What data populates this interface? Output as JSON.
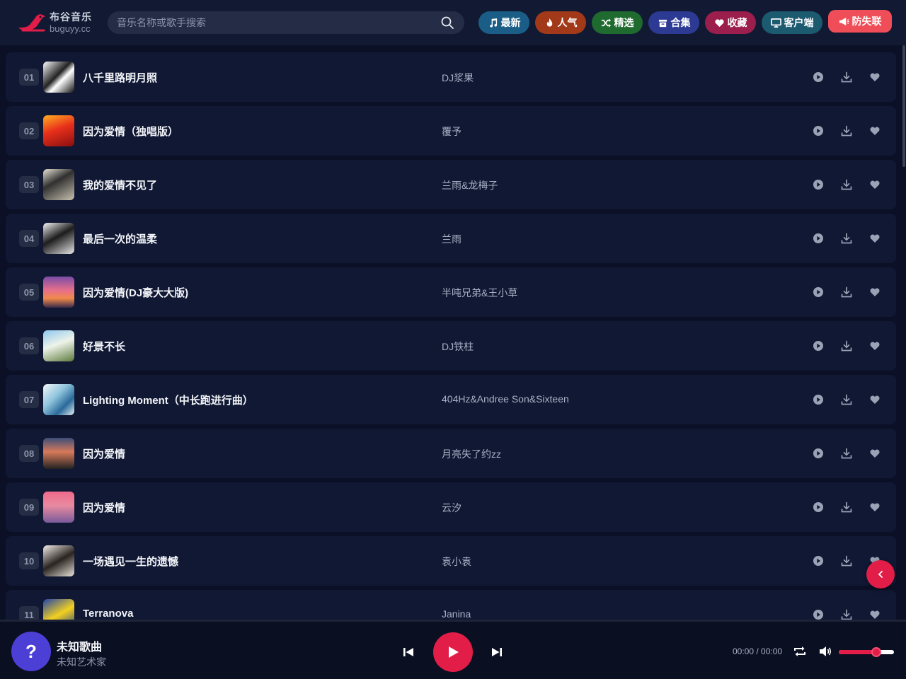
{
  "header": {
    "logo_title": "布谷音乐",
    "logo_sub": "buguyy.cc",
    "search_placeholder": "音乐名称或歌手搜索",
    "nav": [
      {
        "label": "最新",
        "icon": "music-note-icon",
        "color": "#1a5d86"
      },
      {
        "label": "人气",
        "icon": "fire-icon",
        "color": "#a23a1a"
      },
      {
        "label": "精选",
        "icon": "shuffle-icon",
        "color": "#1f6a2f"
      },
      {
        "label": "合集",
        "icon": "box-icon",
        "color": "#2d3a93"
      },
      {
        "label": "收藏",
        "icon": "heart-icon",
        "color": "#9b1e4c"
      },
      {
        "label": "客户端",
        "icon": "monitor-icon",
        "color": "#1c5a70"
      },
      {
        "label": "防失联",
        "icon": "megaphone-icon",
        "color": "#ef4d57"
      }
    ]
  },
  "songs": [
    {
      "num": "01",
      "title": "八千里路明月照",
      "artist": "DJ浆果"
    },
    {
      "num": "02",
      "title": "因为爱情（独唱版）",
      "artist": "覆予"
    },
    {
      "num": "03",
      "title": "我的爱情不见了",
      "artist": "兰雨&龙梅子"
    },
    {
      "num": "04",
      "title": "最后一次的温柔",
      "artist": "兰雨"
    },
    {
      "num": "05",
      "title": "因为爱情(DJ豪大大版)",
      "artist": "半吨兄弟&王小草"
    },
    {
      "num": "06",
      "title": "好景不长",
      "artist": "DJ铁柱"
    },
    {
      "num": "07",
      "title": "Lighting Moment（中长跑进行曲）",
      "artist": "404Hz&Andree Son&Sixteen"
    },
    {
      "num": "08",
      "title": "因为爱情",
      "artist": "月亮失了约zz"
    },
    {
      "num": "09",
      "title": "因为爱情",
      "artist": "云汐"
    },
    {
      "num": "10",
      "title": "一场遇见一生的遗憾",
      "artist": "袁小袁"
    },
    {
      "num": "11",
      "title": "Terranova",
      "artist": "Janina"
    }
  ],
  "player": {
    "avatar_glyph": "?",
    "title": "未知歌曲",
    "artist": "未知艺术家",
    "time": "00:00 / 00:00",
    "volume": 0.68
  },
  "colors": {
    "accent": "#e11d48",
    "background": "#0b1026",
    "row": "#111834"
  }
}
